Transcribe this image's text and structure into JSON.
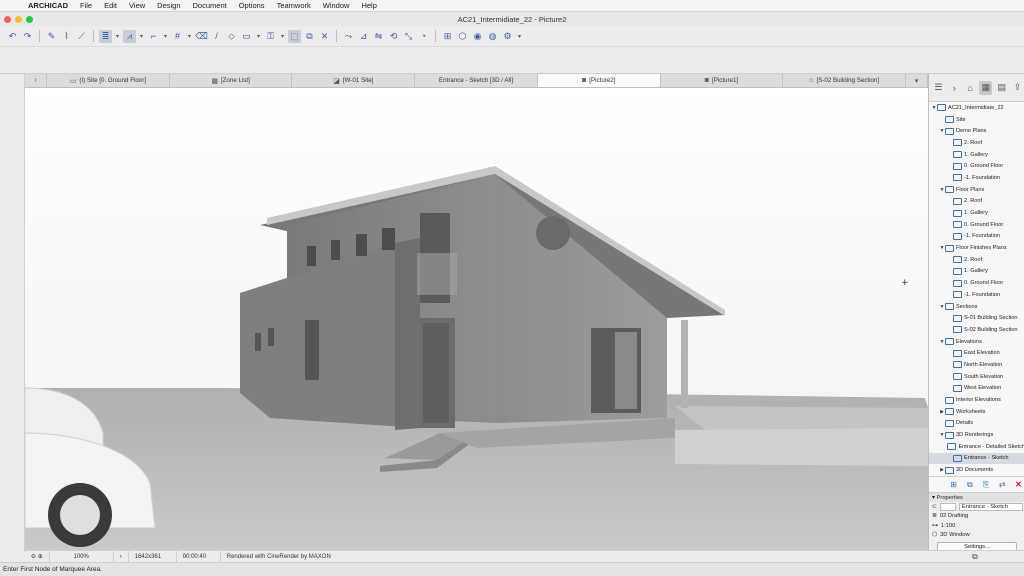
{
  "menubar": {
    "app": "ARCHICAD",
    "items": [
      "File",
      "Edit",
      "View",
      "Design",
      "Document",
      "Options",
      "Teamwork",
      "Window",
      "Help"
    ]
  },
  "window": {
    "title": "AC21_Intermidiate_22 - Picture2"
  },
  "tabs": [
    {
      "label": "(I) Site [0. Ground Floor]",
      "icon": "floor-plan-icon"
    },
    {
      "label": "[Zone List]",
      "icon": "list-icon"
    },
    {
      "label": "[W-01 Site]",
      "icon": "worksheet-icon"
    },
    {
      "label": "Entrance - Sketch [3D / All]",
      "icon": "3d-icon"
    },
    {
      "label": "[Picture2]",
      "icon": "camera-icon",
      "active": true
    },
    {
      "label": "[Picture1]",
      "icon": "camera-icon"
    },
    {
      "label": "[S-02 Building Section]",
      "icon": "section-icon"
    }
  ],
  "status": {
    "zoom": "100%",
    "size": "1642x361",
    "time": "00:00:40",
    "renderer": "Rendered with CineRender by MAXON"
  },
  "prompt": "Enter First Node of Marquee Area.",
  "navigator": {
    "tree": [
      {
        "label": "AC21_Intermidiate_22",
        "level": 0,
        "tri": "▼"
      },
      {
        "label": "Site",
        "level": 1,
        "tri": ""
      },
      {
        "label": "Demo Plans",
        "level": 1,
        "tri": "▼"
      },
      {
        "label": "2. Roof",
        "level": 2,
        "tri": ""
      },
      {
        "label": "1. Gallery",
        "level": 2,
        "tri": ""
      },
      {
        "label": "0. Ground Floor",
        "level": 2,
        "tri": ""
      },
      {
        "label": "-1. Foundation",
        "level": 2,
        "tri": ""
      },
      {
        "label": "Floor Plans",
        "level": 1,
        "tri": "▼"
      },
      {
        "label": "2. Roof",
        "level": 2,
        "tri": ""
      },
      {
        "label": "1. Gallery",
        "level": 2,
        "tri": ""
      },
      {
        "label": "0. Ground Floor",
        "level": 2,
        "tri": ""
      },
      {
        "label": "-1. Foundation",
        "level": 2,
        "tri": ""
      },
      {
        "label": "Floor Finishes Plans",
        "level": 1,
        "tri": "▼"
      },
      {
        "label": "2. Roof",
        "level": 2,
        "tri": ""
      },
      {
        "label": "1. Gallery",
        "level": 2,
        "tri": ""
      },
      {
        "label": "0. Ground Floor",
        "level": 2,
        "tri": ""
      },
      {
        "label": "-1. Foundation",
        "level": 2,
        "tri": ""
      },
      {
        "label": "Sections",
        "level": 1,
        "tri": "▼"
      },
      {
        "label": "S-01 Building Section",
        "level": 2,
        "tri": ""
      },
      {
        "label": "S-02 Building Section",
        "level": 2,
        "tri": ""
      },
      {
        "label": "Elevations",
        "level": 1,
        "tri": "▼"
      },
      {
        "label": "East Elevation",
        "level": 2,
        "tri": ""
      },
      {
        "label": "North Elevation",
        "level": 2,
        "tri": ""
      },
      {
        "label": "South Elevation",
        "level": 2,
        "tri": ""
      },
      {
        "label": "West Elevation",
        "level": 2,
        "tri": ""
      },
      {
        "label": "Interior Elevations",
        "level": 1,
        "tri": ""
      },
      {
        "label": "Worksheets",
        "level": 1,
        "tri": "▶"
      },
      {
        "label": "Details",
        "level": 1,
        "tri": ""
      },
      {
        "label": "3D Renderings",
        "level": 1,
        "tri": "▼"
      },
      {
        "label": "Entrance - Detailed Sketch",
        "level": 2,
        "tri": ""
      },
      {
        "label": "Entrance - Sketch",
        "level": 2,
        "tri": "",
        "selected": true
      },
      {
        "label": "3D Documents",
        "level": 1,
        "tri": "▶"
      }
    ],
    "properties": {
      "header": "Properties",
      "name": "Entrance - Sketch",
      "drafting": "02 Drafting",
      "scale": "1:100",
      "window": "3D Window",
      "settings": "Settings..."
    }
  },
  "colors": {
    "sky": "#f5f5f5",
    "wall": "#8f8f8f",
    "ground": "#b9b9b9",
    "accent": "#3d6fb5"
  }
}
